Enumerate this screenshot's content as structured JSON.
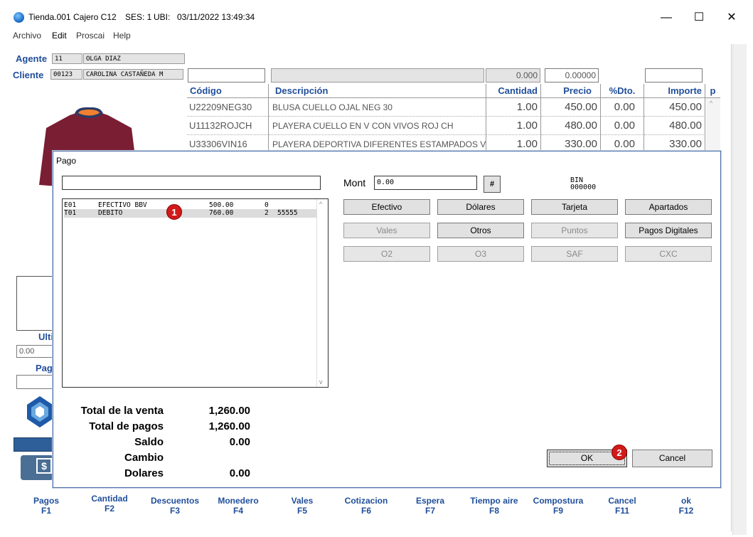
{
  "window": {
    "title_parts": [
      "Tienda.001",
      "Cajero C12",
      "SES: 1",
      "UBI:",
      "03/11/2022 13:49:34"
    ],
    "controls": {
      "minimize": "—",
      "maximize": "☐",
      "close": "✕"
    }
  },
  "menu": [
    "Archivo",
    "Edit",
    "Proscai",
    "Help"
  ],
  "header": {
    "agente_label": "Agente",
    "agente_code": "11",
    "agente_name": "OLGA DIAZ",
    "cliente_label": "Cliente",
    "cliente_code": "00123",
    "cliente_name": "CAROLINA CASTAÑEDA M",
    "field_value_1": "0.000",
    "field_value_2": "0.00000"
  },
  "products": {
    "headers": [
      "Código",
      "Descripción",
      "Cantidad",
      "Precio",
      "%Dto.",
      "Importe",
      "p"
    ],
    "rows": [
      {
        "codigo": "U22209NEG30",
        "descripcion": "BLUSA CUELLO OJAL NEG 30",
        "cantidad": "1.00",
        "precio": "450.00",
        "dto": "0.00",
        "importe": "450.00"
      },
      {
        "codigo": "U11132ROJCH",
        "descripcion": "PLAYERA CUELLO EN V CON VIVOS ROJ CH",
        "cantidad": "1.00",
        "precio": "480.00",
        "dto": "0.00",
        "importe": "480.00"
      },
      {
        "codigo": "U33306VIN16",
        "descripcion": "PLAYERA DEPORTIVA DIFERENTES ESTAMPADOS VI",
        "cantidad": "1.00",
        "precio": "330.00",
        "dto": "0.00",
        "importe": "330.00"
      }
    ]
  },
  "left_panel": {
    "ulti_label": "Ulti",
    "value": "0.00",
    "pag_label": "Pag",
    "dollar": "$"
  },
  "fkeys": [
    {
      "label": "Pagos",
      "key": "F1",
      "color": "#ffffff"
    },
    {
      "label": "Cantidad",
      "key": "F2",
      "color": "#d8e4f2"
    },
    {
      "label": "Descuentos",
      "key": "F3",
      "color": "#ffffff"
    },
    {
      "label": "Monedero",
      "key": "F4",
      "color": "#ffffff"
    },
    {
      "label": "Vales",
      "key": "F5",
      "color": "#d8e4f2"
    },
    {
      "label": "Cotizacion",
      "key": "F6",
      "color": "#d8e4f2"
    },
    {
      "label": "Espera",
      "key": "F7",
      "color": "#d8e4f2"
    },
    {
      "label": "Tiempo aire",
      "key": "F8",
      "color": "#ffffff"
    },
    {
      "label": "Compostura",
      "key": "F9",
      "color": "#d8e4f2"
    },
    {
      "label": "Cancel",
      "key": "F11",
      "color": "#f2c8c8"
    },
    {
      "label": "ok",
      "key": "F12",
      "color": "#d8f0d8"
    }
  ],
  "dialog": {
    "title": "Pago",
    "payments": [
      {
        "code": "E01",
        "name": "EFECTIVO BBV",
        "amount": "500.00",
        "n": "0",
        "ref": ""
      },
      {
        "code": "T01",
        "name": "DEBITO",
        "amount": "760.00",
        "n": "2",
        "ref": "55555"
      }
    ],
    "badge_1": "1",
    "badge_2": "2",
    "mont_label": "Mont",
    "mont_value": "0.00",
    "hash_label": "#",
    "bin_label": "BIN",
    "bin_value": "000000",
    "buttons": [
      {
        "label": "Efectivo",
        "enabled": true
      },
      {
        "label": "Dólares",
        "enabled": true
      },
      {
        "label": "Tarjeta",
        "enabled": true
      },
      {
        "label": "Apartados",
        "enabled": true
      },
      {
        "label": "Vales",
        "enabled": false
      },
      {
        "label": "Otros",
        "enabled": true
      },
      {
        "label": "Puntos",
        "enabled": false
      },
      {
        "label": "Pagos Digitales",
        "enabled": true
      },
      {
        "label": "O2",
        "enabled": false
      },
      {
        "label": "O3",
        "enabled": false
      },
      {
        "label": "SAF",
        "enabled": false
      },
      {
        "label": "CXC",
        "enabled": false
      }
    ],
    "totals": [
      {
        "label": "Total de la venta",
        "value": "1,260.00"
      },
      {
        "label": "Total de pagos",
        "value": "1,260.00"
      },
      {
        "label": "Saldo",
        "value": "0.00"
      },
      {
        "label": "Cambio",
        "value": ""
      },
      {
        "label": "Dolares",
        "value": "0.00"
      }
    ],
    "ok_label": "OK",
    "cancel_label": "Cancel"
  }
}
